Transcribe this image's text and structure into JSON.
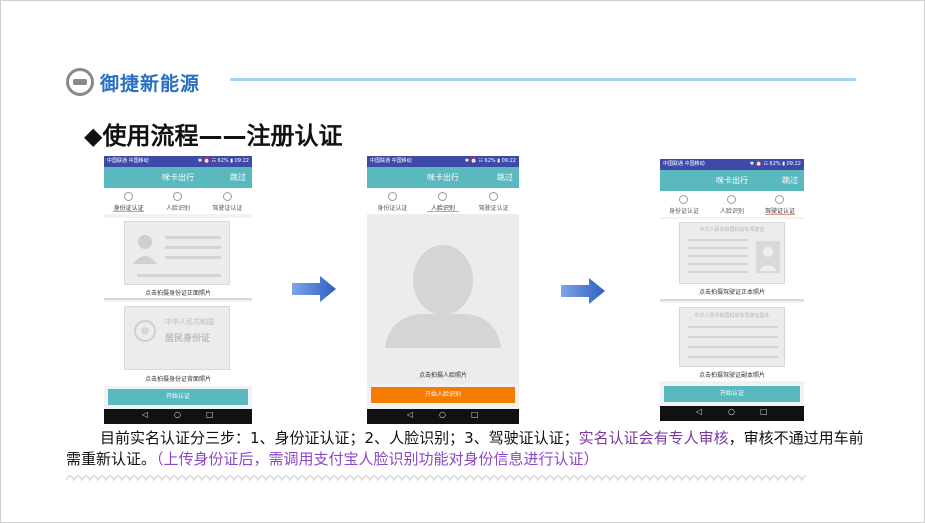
{
  "header": {
    "logo_text": "御捷新能源"
  },
  "title": "◆使用流程——注册认证",
  "phone1": {
    "status_left": "中国联通 中国移动",
    "status_right": "✱ ⏰ ☷ 62% ▮ 09:22",
    "app_title": "咪卡出行",
    "skip_label": "跳过",
    "steps": [
      "身份证认证",
      "人脸识别",
      "驾驶证认证"
    ],
    "front_caption": "点击拍摄身份证正面照片",
    "back_caption": "点击拍摄身份证背面照片",
    "id_back_line1": "中华人民共和国",
    "id_back_line2": "居民身份证",
    "start_button": "开始认证",
    "nav": [
      "◁",
      "○",
      "□"
    ]
  },
  "phone2": {
    "status_left": "中国联通 中国移动",
    "status_right": "✱ ⏰ ☷ 62% ▮ 09:22",
    "app_title": "咪卡出行",
    "skip_label": "跳过",
    "steps": [
      "身份证认证",
      "人脸识别",
      "驾驶证认证"
    ],
    "face_caption": "点击拍摄人脸照片",
    "start_button": "开始人脸识别",
    "nav": [
      "◁",
      "○",
      "□"
    ]
  },
  "phone3": {
    "status_left": "中国联通 中国移动",
    "status_right": "✱ ⏰ ☷ 62% ▮ 09:22",
    "app_title": "咪卡出行",
    "skip_label": "跳过",
    "steps": [
      "身份证认证",
      "人脸识别",
      "驾驶证认证"
    ],
    "license_front_header": "中华人民共和国机动车驾驶证",
    "license_back_header": "中华人民共和国机动车驾驶证副本",
    "front_caption": "点击拍摄驾驶证正本照片",
    "back_caption": "点击拍摄驾驶证副本照片",
    "start_button": "开始认证",
    "nav": [
      "◁",
      "○",
      "□"
    ]
  },
  "description": {
    "part1": "目前实名认证分三步：1、身份证认证；2、人脸识别；3、驾驶证认证；",
    "part2": "实名认证会有专人审核",
    "part3": "，审核不通过用车前需重新认证。",
    "part4": "（上传身份证后，需调用支付宝人脸识别功能对身份信息进行认证）"
  },
  "colors": {
    "accent_teal": "#5ab9be",
    "status_bar": "#3d4aa8",
    "orange_button": "#f57c00",
    "arrow_blue": "#3a6fd1",
    "header_line": "#a7d1ef",
    "purple": "#7a3aa0",
    "violet": "#8b47c8"
  }
}
